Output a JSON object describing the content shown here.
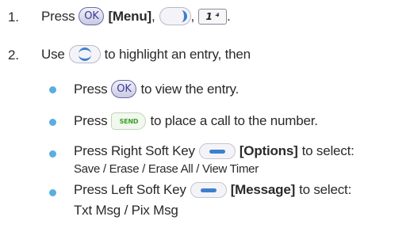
{
  "step1": {
    "number": "1.",
    "press": "Press",
    "ok_icon_text": "OK",
    "menu_label": "[Menu]",
    "comma1": ",",
    "comma2": ",",
    "key1_text": "1 ⁴",
    "period": "."
  },
  "step2": {
    "number": "2.",
    "use": "Use",
    "rest": "to highlight an entry, then"
  },
  "bullets": [
    {
      "prefix": "Press",
      "suffix": "to view the entry."
    },
    {
      "prefix": "Press",
      "send_text": "SEND",
      "suffix": "to place a call to the number."
    },
    {
      "prefix": "Press Right Soft Key",
      "label": "[Options]",
      "suffix": "to select:",
      "sub": "Save / Erase / Erase All / View Timer"
    },
    {
      "prefix": "Press Left Soft Key",
      "label": "[Message]",
      "suffix": "to select:",
      "sub": "Txt Msg / Pix Msg"
    }
  ],
  "colors": {
    "bullet": "#5aaee0",
    "nav_accent": "#3e7fd0",
    "send_green": "#3ca02a"
  },
  "icons": [
    "ok-key-icon",
    "right-nav-key-icon",
    "key-1-icon",
    "up-down-nav-key-icon",
    "send-key-icon",
    "right-soft-key-icon",
    "left-soft-key-icon"
  ]
}
